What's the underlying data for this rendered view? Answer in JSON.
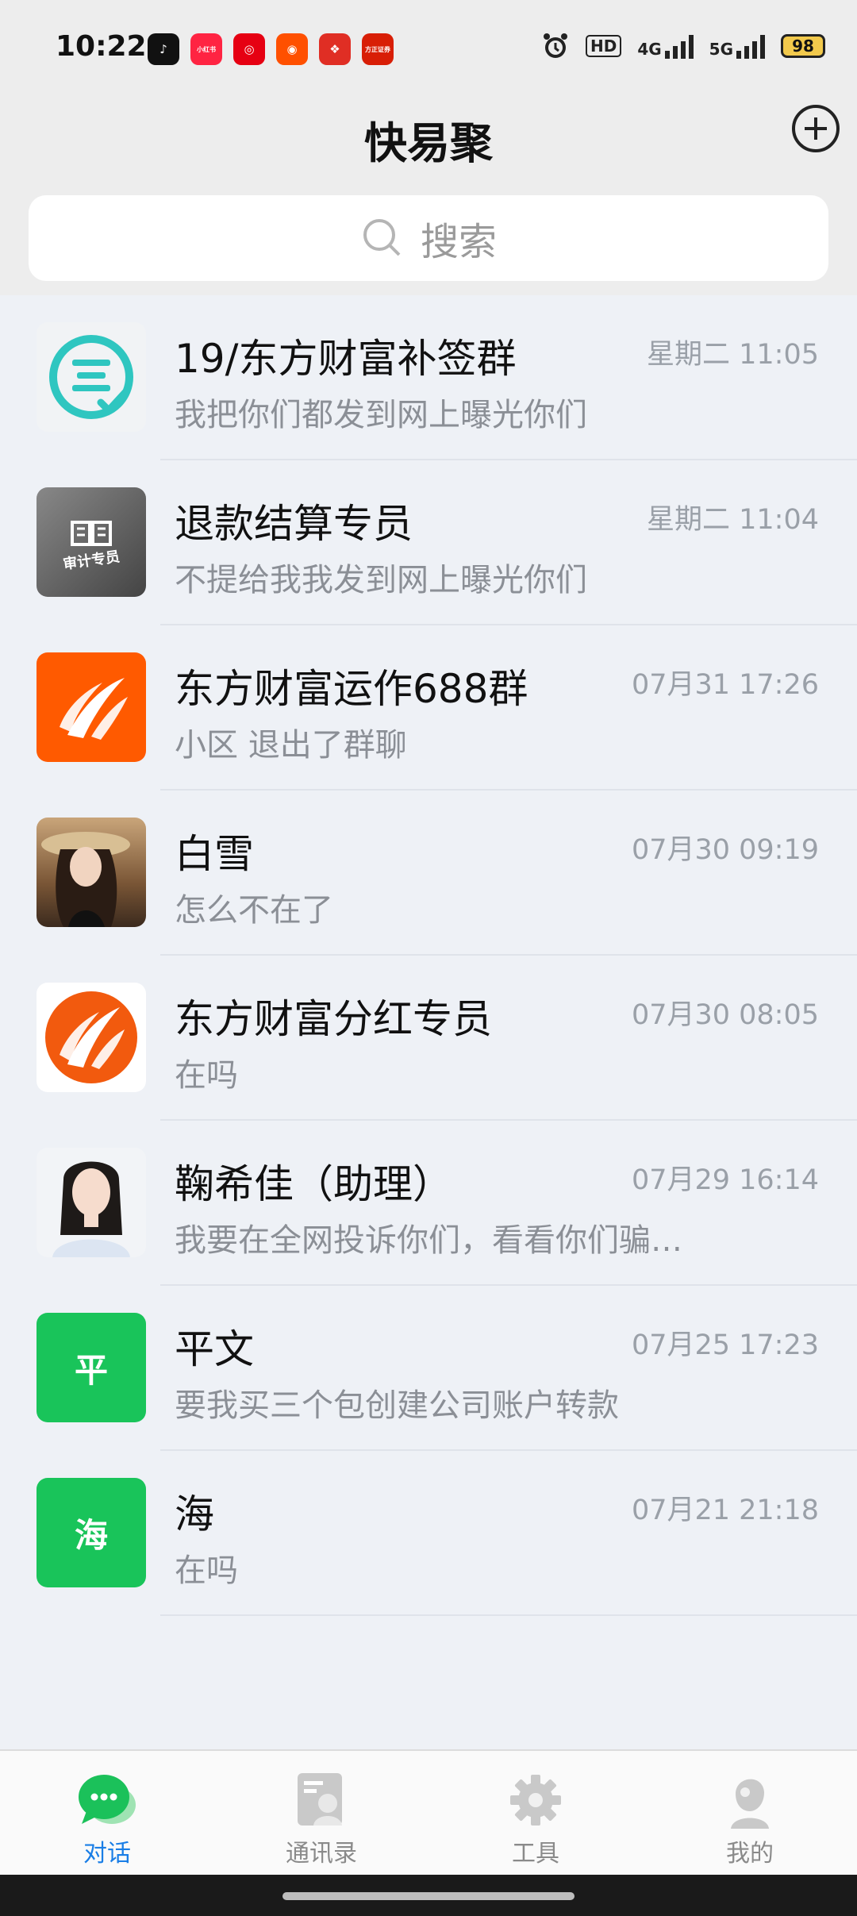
{
  "status_bar": {
    "time": "10:22",
    "app_icons": [
      {
        "name": "tiktok-icon",
        "label": "♪",
        "color": "#111111"
      },
      {
        "name": "xiaohongshu-icon",
        "label": "小红书",
        "color": "#ff2442"
      },
      {
        "name": "netease-icon",
        "label": "◎",
        "color": "#e60012"
      },
      {
        "name": "kuaishou-icon",
        "label": "◉",
        "color": "#ff5000"
      },
      {
        "name": "pinduoduo-icon",
        "label": "❖",
        "color": "#e02e24"
      },
      {
        "name": "securities-icon",
        "label": "方正证券",
        "color": "#d81e06"
      }
    ],
    "hd": "HD",
    "net1": "4G",
    "net2": "5G",
    "battery": "98"
  },
  "header": {
    "title": "快易聚"
  },
  "search": {
    "placeholder": "搜索"
  },
  "chats": [
    {
      "name": "19/东方财富补签群",
      "time": "星期二 11:05",
      "message": "我把你们都发到网上曝光你们",
      "avatar": "sign-badge"
    },
    {
      "name": "退款结算专员",
      "time": "星期二 11:04",
      "message": "不提给我我发到网上曝光你们",
      "avatar": "audit",
      "avatar_text": "审计专员"
    },
    {
      "name": "东方财富运作688群",
      "time": "07月31 17:26",
      "message": "小区 退出了群聊",
      "avatar": "eastmoney-square"
    },
    {
      "name": "白雪",
      "time": "07月30 09:19",
      "message": "怎么不在了",
      "avatar": "photo-woman-hat"
    },
    {
      "name": "东方财富分红专员",
      "time": "07月30 08:05",
      "message": "在吗",
      "avatar": "eastmoney-round"
    },
    {
      "name": "鞠希佳（助理）",
      "time": "07月29 16:14",
      "message": "我要在全网投诉你们，看看你们骗…",
      "avatar": "photo-woman"
    },
    {
      "name": "平文",
      "time": "07月25 17:23",
      "message": "要我买三个包创建公司账户转款",
      "avatar": "text",
      "avatar_text": "平",
      "avatar_color": "#19c45a"
    },
    {
      "name": "海",
      "time": "07月21 21:18",
      "message": "在吗",
      "avatar": "text",
      "avatar_text": "海",
      "avatar_color": "#19c45a"
    }
  ],
  "nav": [
    {
      "label": "对话",
      "icon": "chat-bubble-icon",
      "active": true
    },
    {
      "label": "通讯录",
      "icon": "contacts-icon",
      "active": false
    },
    {
      "label": "工具",
      "icon": "gear-icon",
      "active": false
    },
    {
      "label": "我的",
      "icon": "profile-icon",
      "active": false
    }
  ]
}
